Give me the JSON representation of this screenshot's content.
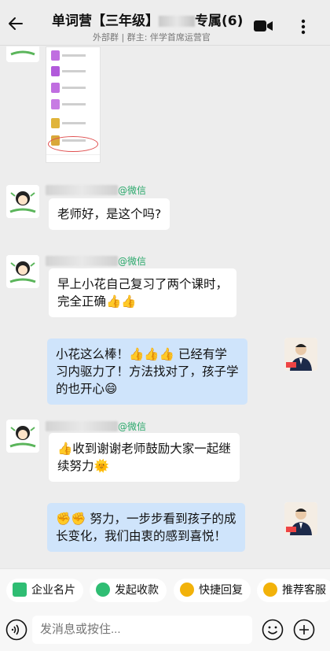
{
  "header": {
    "title_prefix": "单词营【三年级】",
    "title_suffix": "专属(6)",
    "subtitle": "外部群  |  群主: 伴学首席运营官"
  },
  "messages": [
    {
      "sender_tag": "@微信",
      "text": "老师好，是这个吗?"
    },
    {
      "sender_tag": "@微信",
      "text": "早上小花自己复习了两个课时，\n完全正确👍👍"
    },
    {
      "text": "小花这么棒！👍👍👍 已经有学\n习内驱力了！方法找对了，孩子学\n的也开心😄"
    },
    {
      "sender_tag": "@微信",
      "text": "👍收到谢谢老师鼓励大家一起继\n续努力🌞"
    },
    {
      "text": "✊✊ 努力，一步步看到孩子的成\n长变化，我们由衷的感到喜悦！"
    }
  ],
  "quick_actions": [
    "企业名片",
    "发起收款",
    "快捷回复",
    "推荐客服"
  ],
  "input": {
    "placeholder": "发消息或按住..."
  },
  "colors": {
    "bubble_right": "#cfe4fb",
    "wechat_tag": "#2aa86b",
    "chip_green": "#2fbd73",
    "chip_yellow": "#f2b20a"
  }
}
